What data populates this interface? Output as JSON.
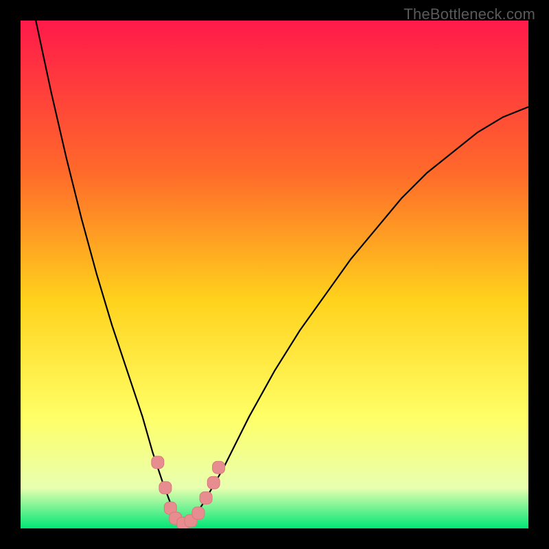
{
  "watermark": "TheBottleneck.com",
  "colors": {
    "gradient_top": "#ff1a4a",
    "gradient_mid1": "#ff6a2a",
    "gradient_mid2": "#ffd21c",
    "gradient_mid3": "#ffff66",
    "gradient_mid4": "#e8ffb0",
    "gradient_bottom": "#00e676",
    "curve": "#000000",
    "marker_fill": "#e88d8f",
    "marker_stroke": "#d67a7c"
  },
  "chart_data": {
    "type": "line",
    "title": "",
    "xlabel": "",
    "ylabel": "",
    "xlim": [
      0,
      100
    ],
    "ylim": [
      0,
      100
    ],
    "series": [
      {
        "name": "bottleneck-curve",
        "x": [
          3,
          6,
          9,
          12,
          15,
          18,
          21,
          24,
          26,
          28,
          29.5,
          31,
          32.5,
          34,
          36,
          40,
          45,
          50,
          55,
          60,
          65,
          70,
          75,
          80,
          85,
          90,
          95,
          100
        ],
        "values": [
          100,
          86,
          73,
          61,
          50,
          40,
          31,
          22,
          15,
          9,
          5,
          2,
          1,
          2,
          5,
          12,
          22,
          31,
          39,
          46,
          53,
          59,
          65,
          70,
          74,
          78,
          81,
          83
        ]
      }
    ],
    "markers": {
      "name": "highlight-points",
      "x": [
        27,
        28.5,
        29.5,
        30.5,
        32,
        33.5,
        35,
        36.5,
        38,
        39
      ],
      "values": [
        13,
        8,
        4,
        2,
        1,
        1.5,
        3,
        6,
        9,
        12
      ]
    }
  }
}
